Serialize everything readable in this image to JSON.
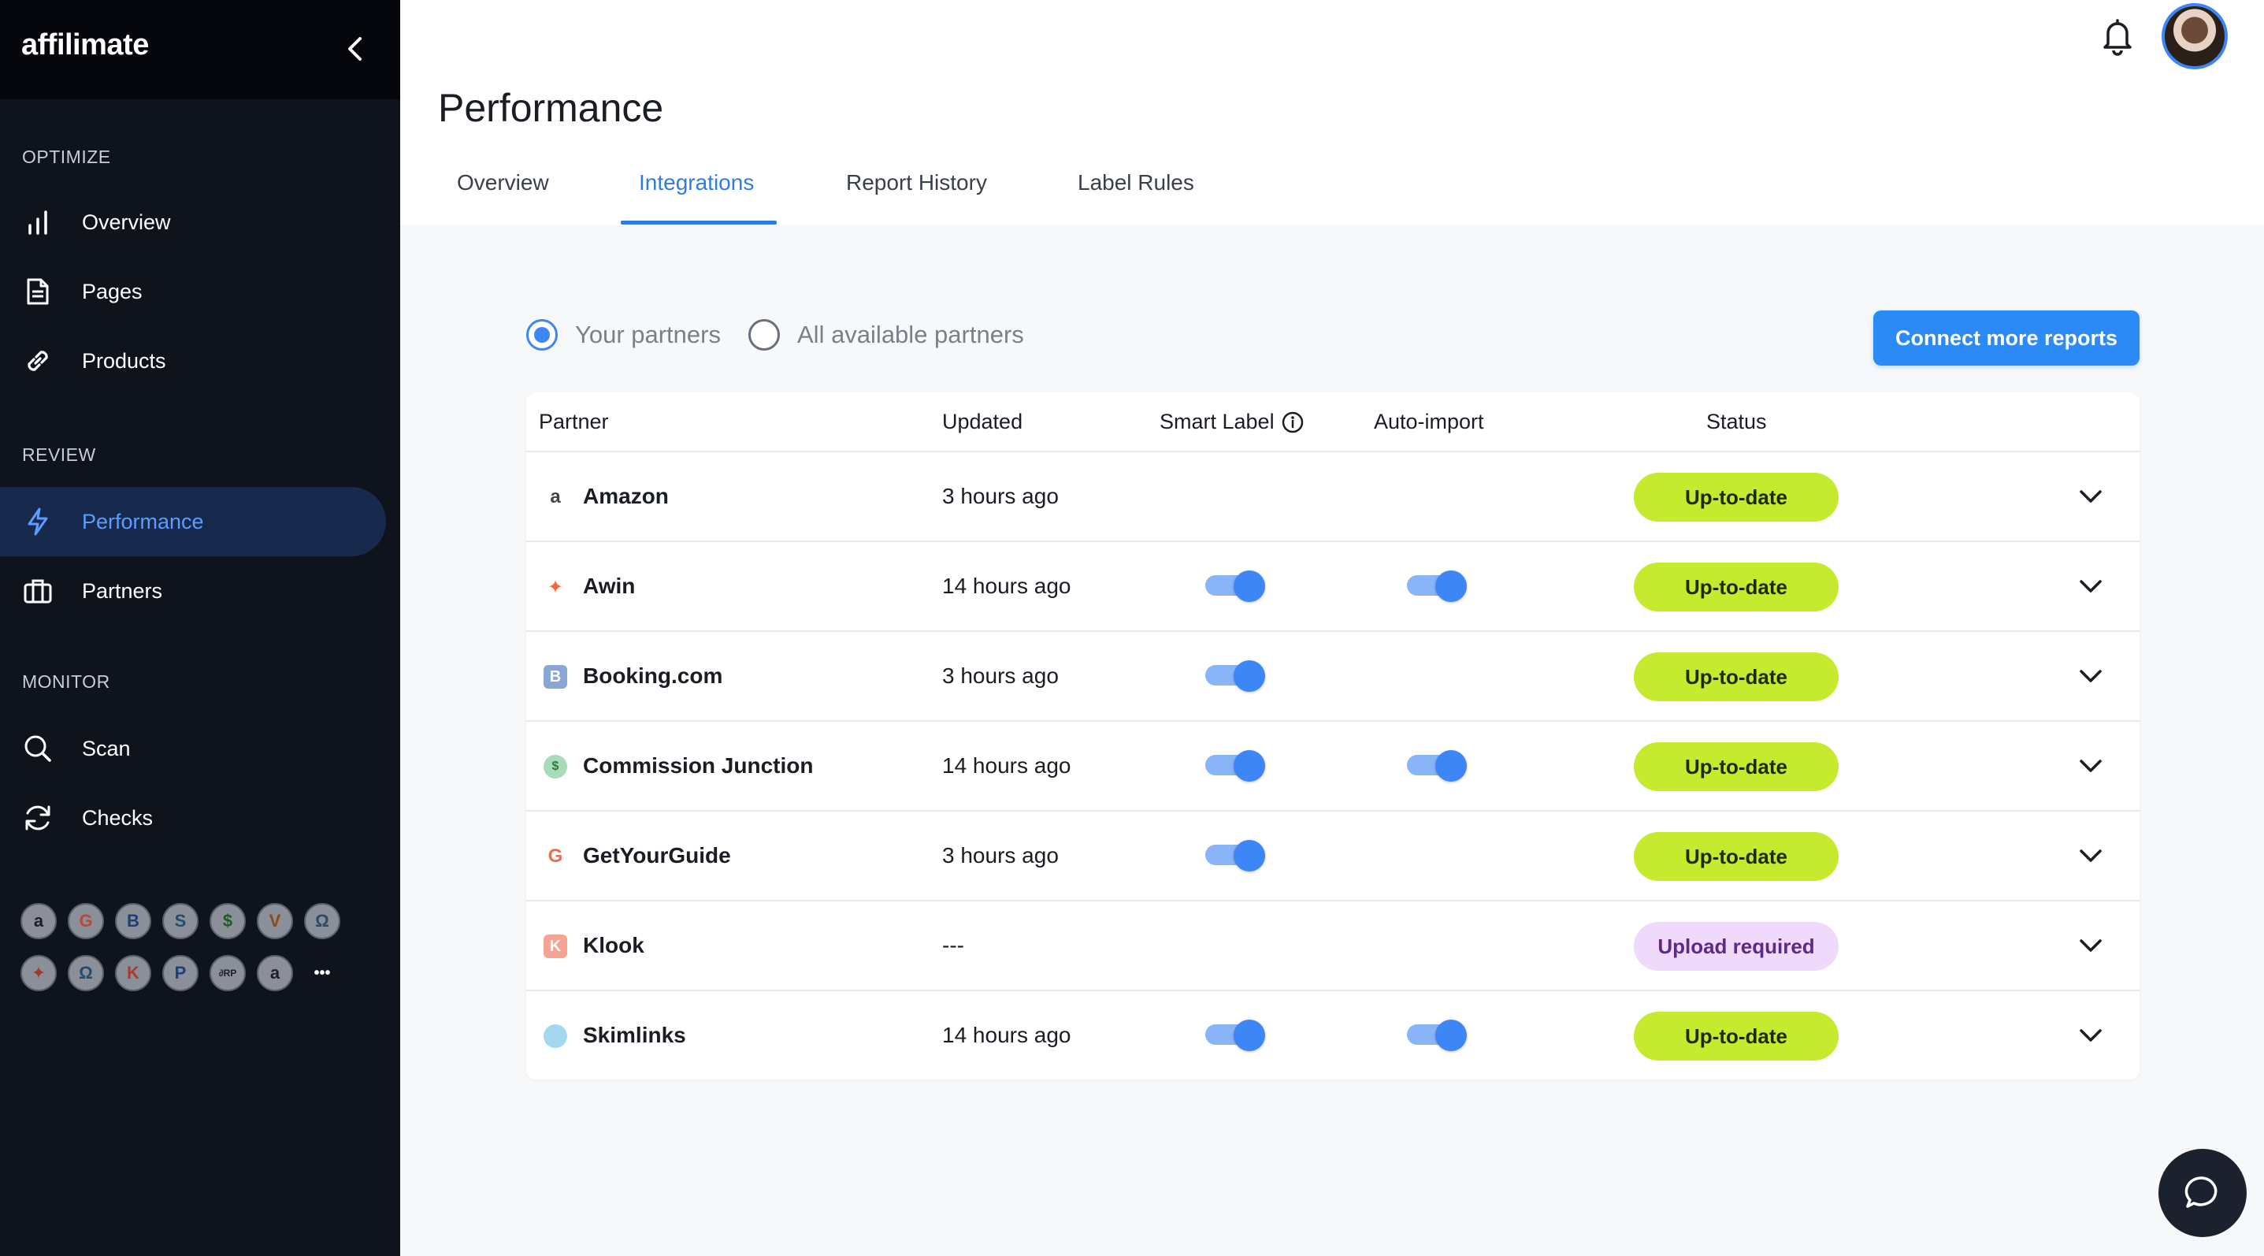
{
  "app": {
    "logo": "affilimate"
  },
  "sidebar": {
    "sections": [
      {
        "title": "OPTIMIZE"
      },
      {
        "title": "REVIEW"
      },
      {
        "title": "MONITOR"
      }
    ],
    "items": [
      {
        "label": "Overview",
        "icon": "bar-chart-icon"
      },
      {
        "label": "Pages",
        "icon": "document-icon"
      },
      {
        "label": "Products",
        "icon": "link-icon"
      },
      {
        "label": "Performance",
        "icon": "lightning-icon",
        "active": true
      },
      {
        "label": "Partners",
        "icon": "briefcase-icon"
      },
      {
        "label": "Scan",
        "icon": "search-icon"
      },
      {
        "label": "Checks",
        "icon": "refresh-icon"
      }
    ],
    "partner_icons": [
      "a",
      "G",
      "B",
      "S",
      "$",
      "V",
      "Ω",
      "✦",
      "Ω",
      "K",
      "P",
      "∂RP",
      "a",
      "•••"
    ]
  },
  "header": {
    "page_title": "Performance"
  },
  "tabs": [
    {
      "label": "Overview"
    },
    {
      "label": "Integrations",
      "active": true
    },
    {
      "label": "Report History"
    },
    {
      "label": "Label Rules"
    }
  ],
  "filters": {
    "your_partners": "Your partners",
    "all_partners": "All available partners",
    "selected": "your_partners"
  },
  "connect_button": "Connect more reports",
  "table": {
    "headers": {
      "partner": "Partner",
      "updated": "Updated",
      "smart_label": "Smart Label",
      "auto_import": "Auto-import",
      "status": "Status"
    },
    "rows": [
      {
        "partner": "Amazon",
        "updated": "3 hours ago",
        "smart_label": false,
        "auto_import": false,
        "status": "Up-to-date"
      },
      {
        "partner": "Awin",
        "updated": "14 hours ago",
        "smart_label": true,
        "auto_import": true,
        "status": "Up-to-date"
      },
      {
        "partner": "Booking.com",
        "updated": "3 hours ago",
        "smart_label": true,
        "auto_import": false,
        "status": "Up-to-date"
      },
      {
        "partner": "Commission Junction",
        "updated": "14 hours ago",
        "smart_label": true,
        "auto_import": true,
        "status": "Up-to-date"
      },
      {
        "partner": "GetYourGuide",
        "updated": "3 hours ago",
        "smart_label": true,
        "auto_import": false,
        "status": "Up-to-date"
      },
      {
        "partner": "Klook",
        "updated": "---",
        "smart_label": false,
        "auto_import": false,
        "status": "Upload required"
      },
      {
        "partner": "Skimlinks",
        "updated": "14 hours ago",
        "smart_label": true,
        "auto_import": true,
        "status": "Up-to-date"
      }
    ]
  },
  "colors": {
    "accent": "#2f7ce8",
    "status_ok": "#c5ea2e",
    "status_upload": "#efdafb",
    "sidebar_bg": "#0f131c"
  }
}
